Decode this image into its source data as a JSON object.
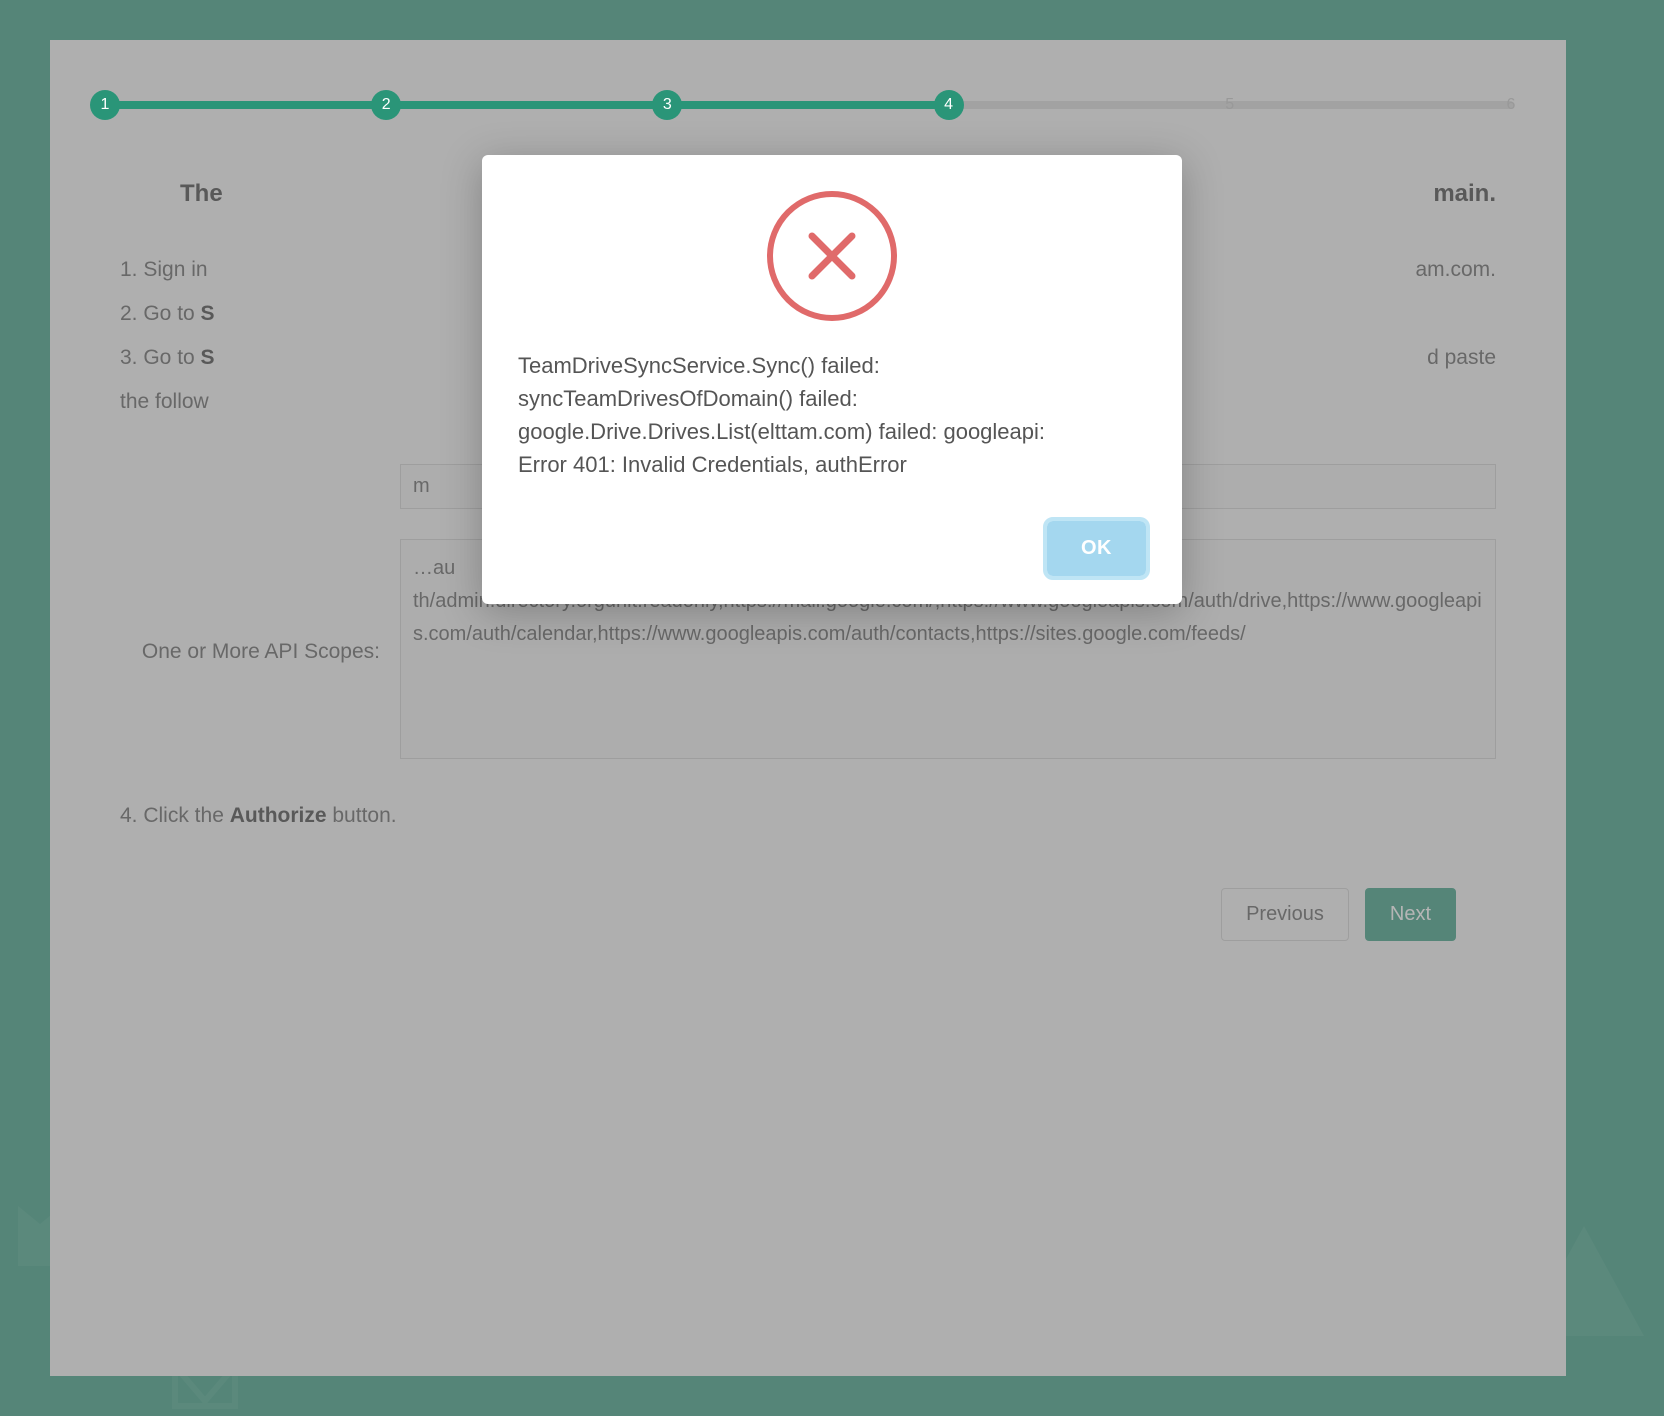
{
  "stepper": {
    "steps": [
      "1",
      "2",
      "3",
      "4",
      "5",
      "6"
    ],
    "current": 4
  },
  "page": {
    "title_prefix": "The ",
    "title_suffix": "main.",
    "instructions": {
      "i1_prefix": "1. Sign in",
      "i1_suffix": "am.com.",
      "i2_prefix": "2. Go to ",
      "i2_bold": "S",
      "i3_prefix": "3. Go to ",
      "i3_bold": "S",
      "i3_suffix": "d paste",
      "i3_cont": "the follow",
      "i4_prefix": "4. Click the ",
      "i4_bold": "Authorize",
      "i4_suffix": " button."
    },
    "client_name_visible": "m",
    "scopes_label": "One or More API Scopes:",
    "scopes_value": "…au\nth/admin.directory.orgunit.readonly,https://mail.google.com/,https://www.googleapis.com/auth/drive,https://www.googleapis.com/auth/calendar,https://www.googleapis.com/auth/contacts,https://sites.google.com/feeds/"
  },
  "buttons": {
    "previous": "Previous",
    "next": "Next"
  },
  "modal": {
    "message": "TeamDriveSyncService.Sync() failed:\nsyncTeamDrivesOfDomain() failed:\ngoogle.Drive.Drives.List(elttam.com) failed: googleapi:\nError 401: Invalid Credentials, authError",
    "ok": "OK"
  }
}
